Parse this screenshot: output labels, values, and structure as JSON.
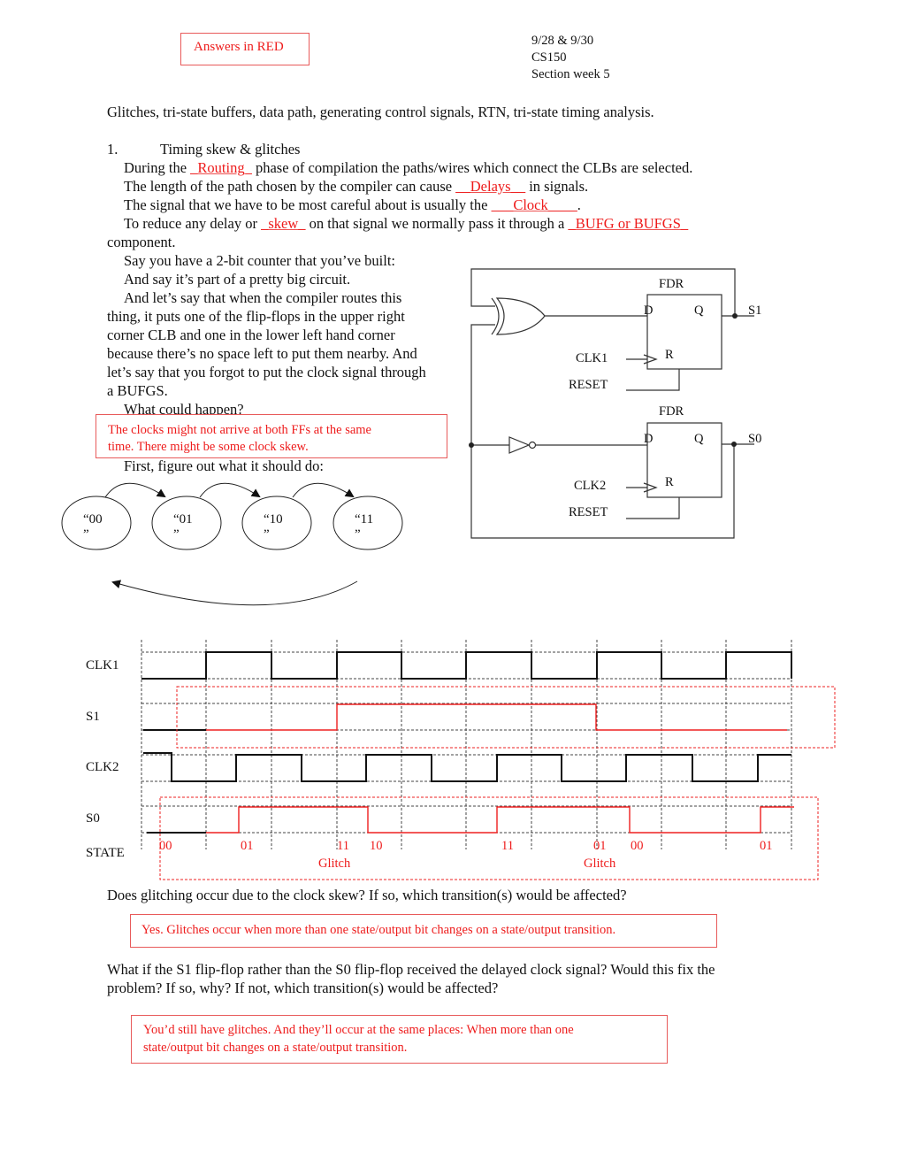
{
  "header": {
    "answers_badge": "Answers in RED",
    "date": "9/28 & 9/30",
    "course": "CS150",
    "section": "Section week 5"
  },
  "topics_line": "Glitches, tri-state buffers, data path, generating control signals, RTN, tri-state timing analysis.",
  "section1": {
    "number": "1.",
    "title": "Timing skew & glitches",
    "fill_ins": {
      "line1_pre": "During the ",
      "line1_blank": "_Routing_",
      "line1_post": " phase of compilation the paths/wires which connect the CLBs are selected.",
      "line2_pre": "The length of the path chosen by the compiler can cause ",
      "line2_blank": "__Delays__",
      "line2_post": " in signals.",
      "line3_pre": "The signal that we have to be most careful about is usually the ",
      "line3_blank": "___Clock____",
      "line3_post": ".",
      "line4_pre": "To reduce any delay or ",
      "line4_blank": "_skew_",
      "line4_mid": " on that signal we normally pass it through a ",
      "line4_blank2": "_BUFG or BUFGS_",
      "line5": "component."
    },
    "paragraph": [
      "Say you have a 2-bit counter that you’ve built:",
      "And say it’s part of a pretty big circuit.",
      "And let’s say that when the compiler routes this",
      "thing, it puts one of the flip-flops in the upper right",
      "corner CLB and one in the lower left hand corner",
      "because there’s no space left to put them nearby. And",
      "let’s say that you forgot to put the clock signal through",
      "a BUFGS.",
      "What could happen?"
    ],
    "answer_what_could_happen": [
      "The clocks might not arrive at both FFs at the same",
      "time. There might be some clock skew."
    ],
    "first_figure": "First, figure out what it should do:"
  },
  "circuit": {
    "ff_top": {
      "title": "FDR",
      "d": "D",
      "q": "Q",
      "r": "R",
      "clk": "CLK1",
      "reset": "RESET",
      "out": "S1"
    },
    "ff_bottom": {
      "title": "FDR",
      "d": "D",
      "q": "Q",
      "r": "R",
      "clk": "CLK2",
      "reset": "RESET",
      "out": "S0"
    },
    "gates": [
      "xor-gate",
      "inverter"
    ]
  },
  "state_diagram": {
    "states": [
      {
        "l1": "“00",
        "l2": "”"
      },
      {
        "l1": "“01",
        "l2": "”"
      },
      {
        "l1": "“10",
        "l2": "”"
      },
      {
        "l1": "“11",
        "l2": "”"
      }
    ]
  },
  "timing": {
    "signals": [
      "CLK1",
      "S1",
      "CLK2",
      "S0",
      "STATE"
    ],
    "state_labels": [
      {
        "text": "00"
      },
      {
        "text": "01"
      },
      {
        "text": "11"
      },
      {
        "text": "10"
      },
      {
        "text": "11"
      },
      {
        "text": "01"
      },
      {
        "text": "00"
      },
      {
        "text": "01"
      }
    ],
    "glitch_labels": [
      "Glitch",
      "Glitch"
    ]
  },
  "questions": {
    "q1": "Does glitching occur due to the clock skew? If so, which transition(s) would be affected?",
    "a1": "Yes. Glitches occur when more than one state/output bit changes on a state/output transition.",
    "q2_l1": "What if the S1 flip-flop rather than the S0 flip-flop received the delayed clock signal? Would this fix the",
    "q2_l2": "problem? If so, why? If not, which transition(s) would be affected?",
    "a2_l1": "You’d still have glitches. And they’ll occur at the same places: When more than one",
    "a2_l2": "state/output bit changes on a state/output transition."
  }
}
